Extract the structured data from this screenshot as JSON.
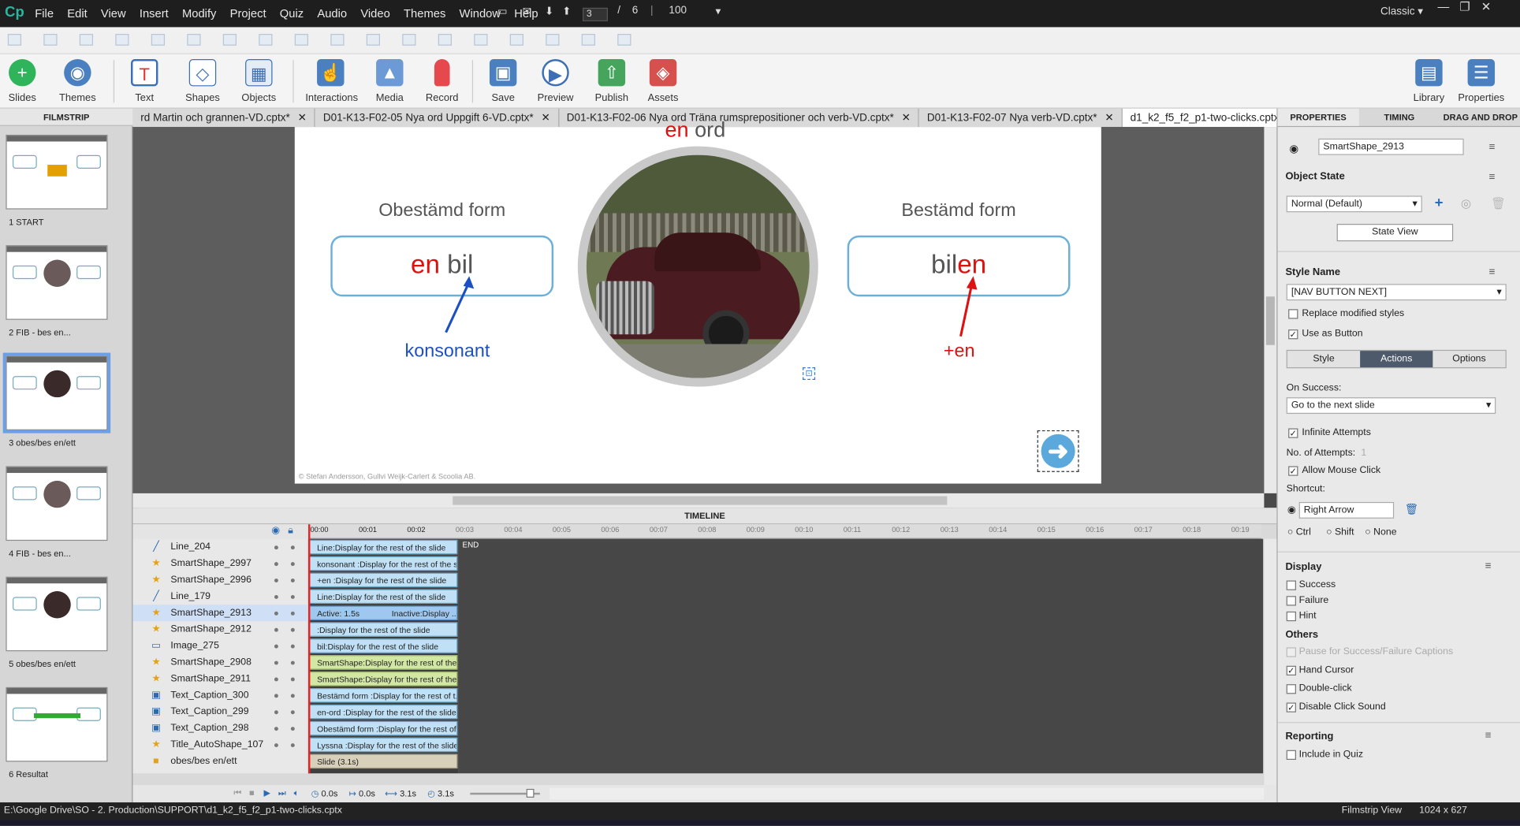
{
  "app": {
    "logo": "Cp",
    "workspace": "Classic",
    "zoom": "100",
    "page_current": "3",
    "page_total": "6"
  },
  "menu": [
    "File",
    "Edit",
    "View",
    "Insert",
    "Modify",
    "Project",
    "Quiz",
    "Audio",
    "Video",
    "Themes",
    "Window",
    "Help"
  ],
  "toolbar": {
    "slides": "Slides",
    "themes": "Themes",
    "text": "Text",
    "shapes": "Shapes",
    "objects": "Objects",
    "interactions": "Interactions",
    "media": "Media",
    "record": "Record",
    "save": "Save",
    "preview": "Preview",
    "publish": "Publish",
    "assets": "Assets",
    "library": "Library",
    "properties": "Properties"
  },
  "filmstrip": {
    "title": "FILMSTRIP",
    "slides": [
      {
        "label": "1 START"
      },
      {
        "label": "2 FIB - bes en..."
      },
      {
        "label": "3 obes/bes en/ett"
      },
      {
        "label": "4 FIB - bes en..."
      },
      {
        "label": "5 obes/bes en/ett"
      },
      {
        "label": "6 Resultat"
      }
    ]
  },
  "tabs": [
    "rd Martin och grannen-VD.cptx*",
    "D01-K13-F02-05 Nya ord Uppgift 6-VD.cptx*",
    "D01-K13-F02-06 Nya ord Träna rumsprepositioner och verb-VD.cptx*",
    "D01-K13-F02-07 Nya verb-VD.cptx*",
    "d1_k2_f5_f2_p1-two-clicks.cptx*"
  ],
  "tabs_more": ">>",
  "slide": {
    "top_title_a": "en",
    "top_title_b": "ord",
    "left_heading": "Obestämd form",
    "left_word_a": "en",
    "left_word_b": "bil",
    "left_note": "konsonant",
    "right_heading": "Bestämd form",
    "right_word_a": "bil",
    "right_word_b": "en",
    "right_note": "+en",
    "copyright": "© Stefan Andersson, Gullvi Weijk-Carlert & Scoolia AB."
  },
  "timeline": {
    "title": "TIMELINE",
    "ticks": [
      "00:00",
      "00:01",
      "00:02",
      "00:03",
      "00:04",
      "00:05",
      "00:06",
      "00:07",
      "00:08",
      "00:09",
      "00:10",
      "00:11",
      "00:12",
      "00:13",
      "00:14",
      "00:15",
      "00:16",
      "00:17",
      "00:18",
      "00:19"
    ],
    "end_label": "END",
    "rows": [
      {
        "name": "Line_204",
        "bar": "Line:Display for the rest of the slide",
        "kind": "line"
      },
      {
        "name": "SmartShape_2997",
        "bar": "konsonant :Display for the rest of the sl...",
        "kind": "star"
      },
      {
        "name": "SmartShape_2996",
        "bar": "+en :Display for the rest of the slide",
        "kind": "star"
      },
      {
        "name": "Line_179",
        "bar": "Line:Display for the rest of the slide",
        "kind": "line"
      },
      {
        "name": "SmartShape_2913",
        "bar": "Active: 1.5s",
        "bar2": "Inactive:Display ...",
        "kind": "star",
        "selected": true
      },
      {
        "name": "SmartShape_2912",
        "bar": " :Display for the rest of the slide",
        "kind": "star"
      },
      {
        "name": "Image_275",
        "bar": "bil:Display for the rest of the slide",
        "kind": "image"
      },
      {
        "name": "SmartShape_2908",
        "bar": "SmartShape:Display for the rest of the ...",
        "kind": "star",
        "green": true
      },
      {
        "name": "SmartShape_2911",
        "bar": "SmartShape:Display for the rest of the ...",
        "kind": "star",
        "green": true
      },
      {
        "name": "Text_Caption_300",
        "bar": "Bestämd form :Display for the rest of t...",
        "kind": "caption"
      },
      {
        "name": "Text_Caption_299",
        "bar": "en-ord :Display for the rest of the slide",
        "kind": "caption"
      },
      {
        "name": "Text_Caption_298",
        "bar": "Obestämd form :Display for the rest of ...",
        "kind": "caption"
      },
      {
        "name": "Title_AutoShape_107",
        "bar": "Lyssna :Display for the rest of the slide",
        "kind": "star"
      },
      {
        "name": "obes/bes en/ett",
        "bar": "Slide (3.1s)",
        "kind": "slide"
      }
    ],
    "footer": {
      "t1": "0.0s",
      "t2": "0.0s",
      "t3": "3.1s",
      "t4": "3.1s"
    }
  },
  "properties": {
    "tabs": [
      "PROPERTIES",
      "TIMING",
      "DRAG AND DROP"
    ],
    "object_name": "SmartShape_2913",
    "object_state_label": "Object State",
    "state_value": "Normal (Default)",
    "state_view": "State View",
    "style_name_label": "Style Name",
    "style_value": "[NAV BUTTON NEXT]",
    "replace_styles": "Replace modified styles",
    "use_as_button": "Use as Button",
    "subtabs": [
      "Style",
      "Actions",
      "Options"
    ],
    "on_success_label": "On Success:",
    "on_success_value": "Go to the next slide",
    "infinite_attempts": "Infinite Attempts",
    "num_attempts_label": "No. of Attempts:",
    "num_attempts_value": "1",
    "allow_mouse": "Allow Mouse Click",
    "shortcut_label": "Shortcut:",
    "shortcut_value": "Right Arrow",
    "mods": [
      "Ctrl",
      "Shift",
      "None"
    ],
    "display_label": "Display",
    "display_items": [
      "Success",
      "Failure",
      "Hint"
    ],
    "others_label": "Others",
    "others_items": [
      {
        "label": "Pause for Success/Failure Captions",
        "checked": false,
        "disabled": true
      },
      {
        "label": "Hand Cursor",
        "checked": true
      },
      {
        "label": "Double-click",
        "checked": false
      },
      {
        "label": "Disable Click Sound",
        "checked": true
      }
    ],
    "reporting_label": "Reporting",
    "include_quiz": "Include in Quiz"
  },
  "status": {
    "path": "E:\\Google Drive\\SO - 2. Production\\SUPPORT\\d1_k2_f5_f2_p1-two-clicks.cptx",
    "view": "Filmstrip View",
    "size": "1024 x 627"
  }
}
